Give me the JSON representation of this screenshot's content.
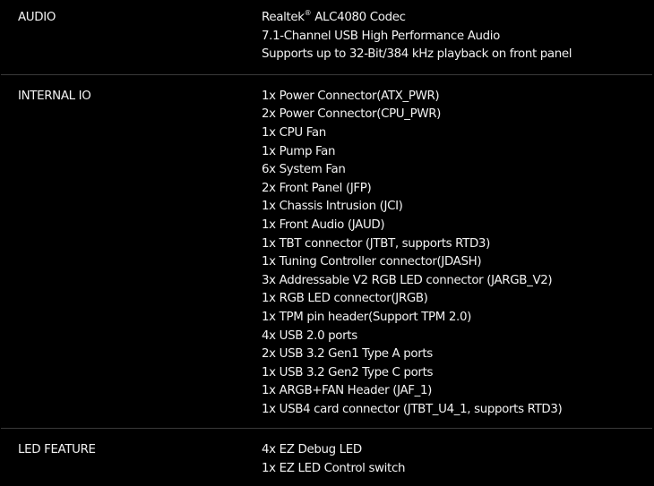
{
  "sections": [
    {
      "label": "AUDIO",
      "values": [
        "Realtek",
        "7.1-Channel USB High Performance Audio",
        "Supports up to 32-Bit/384 kHz playback on front panel"
      ],
      "first_value_suffix": " ALC4080 Codec",
      "first_value_sup": "®"
    },
    {
      "label": "INTERNAL IO",
      "values": [
        "1x Power Connector(ATX_PWR)",
        "2x Power Connector(CPU_PWR)",
        "1x CPU Fan",
        "1x Pump Fan",
        "6x System Fan",
        "2x Front Panel (JFP)",
        "1x Chassis Intrusion (JCI)",
        "1x Front Audio (JAUD)",
        "1x TBT connector (JTBT, supports RTD3)",
        "1x Tuning Controller connector(JDASH)",
        "3x Addressable V2 RGB LED connector (JARGB_V2)",
        "1x RGB LED connector(JRGB)",
        "1x TPM pin header(Support TPM 2.0)",
        "4x USB 2.0 ports",
        "2x USB 3.2 Gen1 Type A ports",
        "1x USB 3.2 Gen2 Type C ports",
        "1x ARGB+FAN Header (JAF_1)",
        "1x USB4 card connector (JTBT_U4_1, supports RTD3)"
      ]
    },
    {
      "label": "LED FEATURE",
      "values": [
        "4x EZ Debug LED",
        "1x EZ LED Control switch"
      ]
    }
  ],
  "colors": {
    "background": "#000000",
    "text": "#f2f2f2",
    "divider": "#3a3a3a"
  }
}
